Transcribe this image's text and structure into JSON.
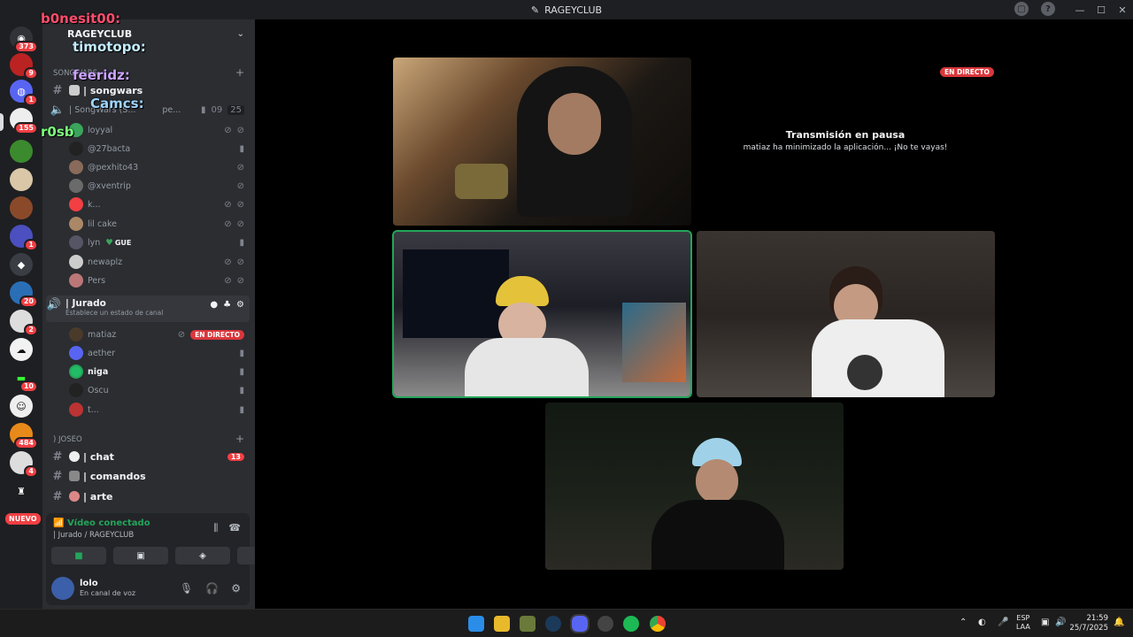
{
  "window": {
    "title": "RAGEYCLUB"
  },
  "rail": {
    "badges": [
      "373",
      "9",
      "1",
      "155",
      "1",
      "20",
      "2",
      "10",
      "484",
      "4"
    ],
    "new_label": "NUEVO"
  },
  "server": {
    "name": "RAGEYCLUB"
  },
  "overlay": {
    "names": [
      {
        "text": "b0nesit00:",
        "color": "#ff4d6d"
      },
      {
        "text": "timotopo:",
        "color": "#c2ecff"
      },
      {
        "text": "feeridz:",
        "color": "#cba4ff"
      },
      {
        "text": "Camcs:",
        "color": "#9fd4ff"
      },
      {
        "text": "r0sb",
        "color": "#7cff7c"
      }
    ]
  },
  "channels": {
    "category1": "SONGWARS",
    "songwars_text": "| songwars",
    "songwars_voice": "| SongWars (S...",
    "songwars_voice_suffix": "pe...",
    "songwars_count_a": "09",
    "songwars_count_b": "25",
    "songwars_users": [
      "loyyal",
      "@27bacta",
      "@pexhito43",
      "@xventrip",
      "k...",
      "lil cake",
      "lyn",
      "newaplz",
      "Pers"
    ],
    "lyn_tag": "GUE",
    "jurado": {
      "name": "| Jurado",
      "status_hint": "Establece un estado de canal",
      "users": [
        "matiaz",
        "aether",
        "niga",
        "Oscu",
        "t..."
      ],
      "live_label": "EN DIRECTO"
    },
    "category2": ") JOSEO",
    "text_channels": [
      {
        "name": "| chat",
        "badge": "13"
      },
      {
        "name": "| comandos",
        "badge": ""
      },
      {
        "name": "| arte",
        "badge": ""
      }
    ]
  },
  "voice_panel": {
    "status": "Vídeo conectado",
    "location": "| Jurado / RAGEYCLUB"
  },
  "user_panel": {
    "name": "lolo",
    "status": "En canal de voz"
  },
  "stage": {
    "live_label": "EN DIRECTO",
    "paused_title": "Transmisión en pausa",
    "paused_subtitle": "matiaz ha minimizado la aplicación... ¡No te vayas!"
  },
  "taskbar": {
    "lang_top": "ESP",
    "lang_bottom": "LAA",
    "time": "21:59",
    "date": "25/7/2025"
  }
}
